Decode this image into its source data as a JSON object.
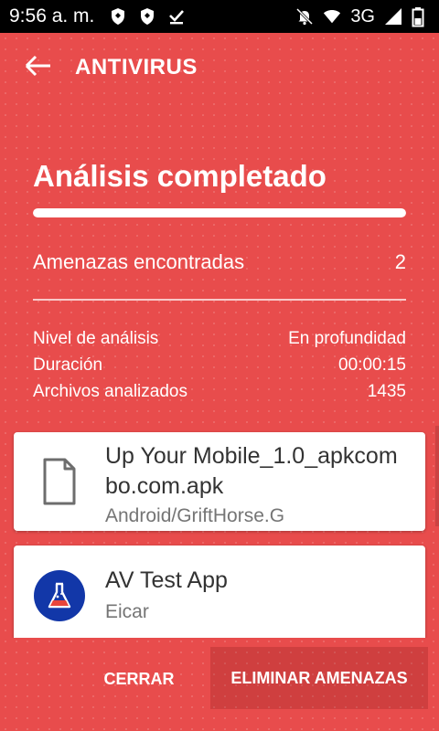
{
  "status_bar": {
    "time": "9:56 a. m.",
    "network": "3G",
    "icons": [
      "shield-icon",
      "shield-icon",
      "checkmark-icon",
      "notifications-off-icon",
      "wifi-icon",
      "signal-icon",
      "battery-icon"
    ]
  },
  "app_bar": {
    "title": "ANTIVIRUS",
    "back_icon": "arrow-back-icon"
  },
  "scan": {
    "title": "Análisis completado",
    "progress": 1.0,
    "threats_label": "Amenazas encontradas",
    "threats_count": "2",
    "stats": [
      {
        "label": "Nivel de análisis",
        "value": "En profundidad"
      },
      {
        "label": "Duración",
        "value": "00:00:15"
      },
      {
        "label": "Archivos analizados",
        "value": "1435"
      }
    ]
  },
  "results": [
    {
      "name": "Up Your Mobile_1.0_apkcombo.com.apk",
      "threat": "Android/GriftHorse.G",
      "icon": "file-icon"
    },
    {
      "name": "AV Test App",
      "threat": "Eicar",
      "icon": "flask-app-icon"
    }
  ],
  "actions": {
    "close": "CERRAR",
    "remove": "ELIMINAR AMENAZAS"
  },
  "colors": {
    "background": "#e84c4c",
    "card": "#ffffff",
    "av_logo": "#1237a8"
  }
}
